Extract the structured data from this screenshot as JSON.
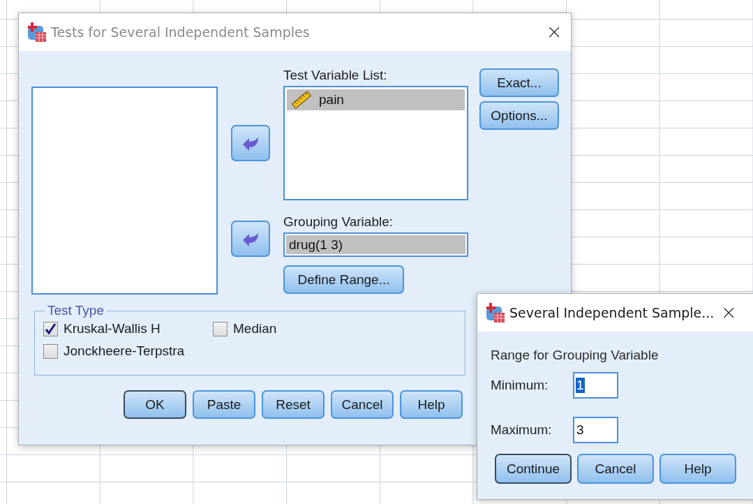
{
  "main_dialog": {
    "title": "Tests for Several Independent Samples",
    "active": false,
    "close": "×",
    "test_variable_list": {
      "label": "Test Variable List:",
      "items": [
        {
          "name": "pain",
          "selected": true
        }
      ]
    },
    "grouping_variable": {
      "label": "Grouping Variable:",
      "value": "drug(1 3)"
    },
    "define_range": {
      "label": "Define Range..."
    },
    "side_buttons": [
      {
        "label": "Exact..."
      },
      {
        "label": "Options..."
      }
    ],
    "test_type": {
      "legend": "Test Type",
      "options": [
        {
          "label": "Kruskal-Wallis H",
          "checked": true
        },
        {
          "label": "Median",
          "checked": false
        },
        {
          "label": "Jonckheere-Terpstra",
          "checked": false
        }
      ]
    },
    "buttons": [
      {
        "label": "OK",
        "default": true
      },
      {
        "label": "Paste",
        "default": false
      },
      {
        "label": "Reset",
        "default": false
      },
      {
        "label": "Cancel",
        "default": false
      },
      {
        "label": "Help",
        "default": false
      }
    ]
  },
  "range_dialog": {
    "title": "Several Independent Sample...",
    "active": true,
    "close": "×",
    "heading": "Range for Grouping Variable",
    "fields": [
      {
        "label": "Minimum:",
        "value": "1",
        "text_selected": true
      },
      {
        "label": "Maximum:",
        "value": "3",
        "text_selected": false
      }
    ],
    "buttons": [
      {
        "label": "Continue",
        "default": true
      },
      {
        "label": "Cancel",
        "default": false
      },
      {
        "label": "Help",
        "default": false
      }
    ]
  }
}
